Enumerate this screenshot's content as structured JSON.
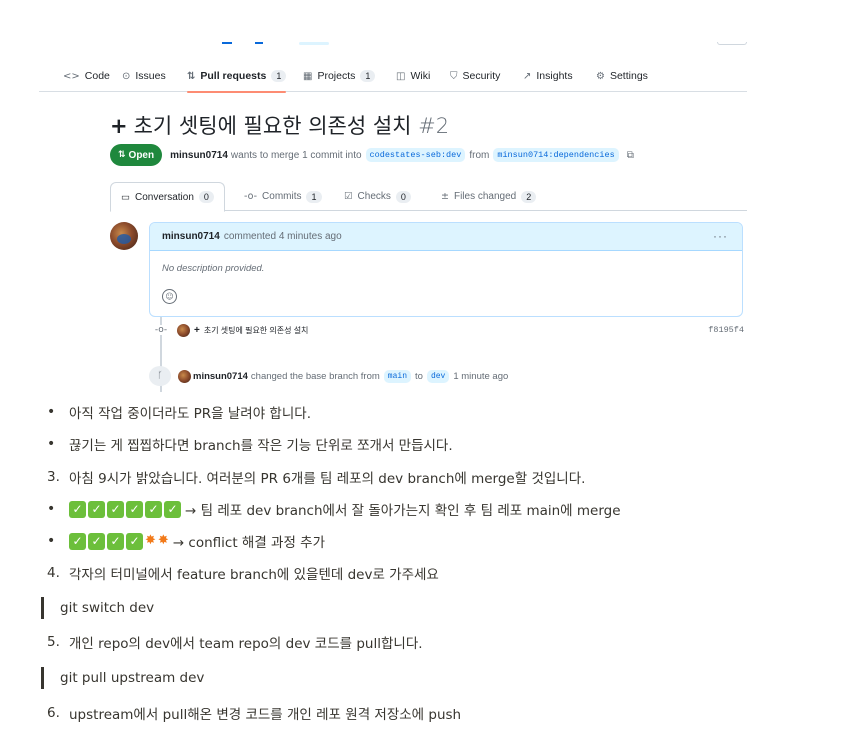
{
  "repo_nav": {
    "tabs": [
      {
        "icon": "code-icon",
        "glyph": "<>",
        "label": "Code",
        "count": ""
      },
      {
        "icon": "issue-icon",
        "glyph": "⊙",
        "label": "Issues",
        "count": ""
      },
      {
        "icon": "pull-request-icon",
        "glyph": "⇅",
        "label": "Pull requests",
        "count": "1"
      },
      {
        "icon": "projects-icon",
        "glyph": "▦",
        "label": "Projects",
        "count": "1"
      },
      {
        "icon": "wiki-icon",
        "glyph": "◫",
        "label": "Wiki",
        "count": ""
      },
      {
        "icon": "shield-icon",
        "glyph": "⛉",
        "label": "Security",
        "count": ""
      },
      {
        "icon": "graph-icon",
        "glyph": "↗",
        "label": "Insights",
        "count": ""
      },
      {
        "icon": "gear-icon",
        "glyph": "⚙",
        "label": "Settings",
        "count": ""
      }
    ]
  },
  "pr": {
    "title": "초기 셋팅에 필요한 의존성 설치",
    "number": "#2",
    "status": "Open",
    "author": "minsun0714",
    "merge_text": "wants to merge 1 commit into",
    "base_branch": "codestates-seb:dev",
    "from_text": "from",
    "head_branch": "minsun0714:dependencies"
  },
  "pr_tabs": [
    {
      "icon": "conversation-icon",
      "glyph": "▭",
      "label": "Conversation",
      "count": "0"
    },
    {
      "icon": "commits-icon",
      "glyph": "-o-",
      "label": "Commits",
      "count": "1"
    },
    {
      "icon": "checks-icon",
      "glyph": "☑",
      "label": "Checks",
      "count": "0"
    },
    {
      "icon": "files-icon",
      "glyph": "±",
      "label": "Files changed",
      "count": "2"
    }
  ],
  "comment": {
    "author": "minsun0714",
    "meta": "commented 4 minutes ago",
    "body": "No description provided.",
    "menu": "···"
  },
  "commit": {
    "message": "초기 셋팅에 필요한 의존성 설치",
    "sha": "f8195f4"
  },
  "event": {
    "author": "minsun0714",
    "text1": "changed the base branch from",
    "from_branch": "main",
    "to_text": "to",
    "to_branch": "dev",
    "time": "1 minute ago"
  },
  "notes": {
    "bullet1": "아직 작업 중이더라도 PR을 날려야 합니다.",
    "bullet2": "끊기는 게 찝찝하다면 branch를 작은 기능 단위로 쪼개서 만듭시다.",
    "step3_num": "3.",
    "step3": "아침 9시가 밝았습니다. 여러분의 PR 6개를 팀 레포의 dev branch에 merge할 것입니다.",
    "bullet3": "→ 팀 레포 dev branch에서 잘 돌아가는지 확인 후 팀 레포 main에 merge",
    "bullet4": "→ conflict 해결 과정 추가",
    "step4_num": "4.",
    "step4": "각자의 터미널에서 feature branch에 있을텐데 dev로 가주세요",
    "quote1": "git switch dev",
    "step5_num": "5.",
    "step5": "개인 repo의 dev에서 team repo의 dev 코드를 pull합니다.",
    "quote2": "git pull upstream dev",
    "step6_num": "6.",
    "step6": "upstream에서 pull해온 변경 코드를 개인 레포 원격 저장소에 push"
  }
}
